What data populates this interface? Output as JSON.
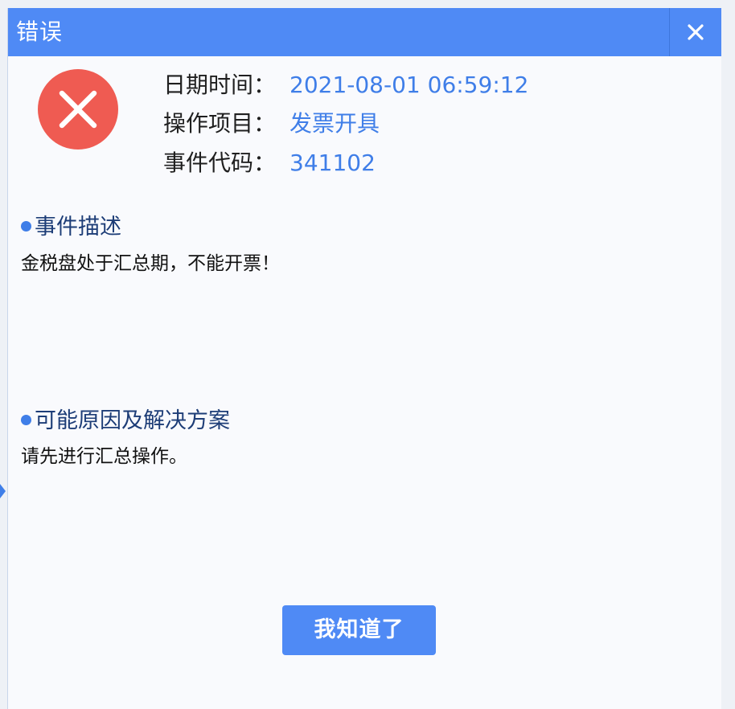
{
  "window": {
    "title": "错误",
    "close_icon": "close-icon"
  },
  "status_icon": "error-x-icon",
  "colors": {
    "titlebar": "#4f8af5",
    "error": "#ef5b52",
    "value_text": "#3f7ee8",
    "section_heading": "#1d3d77"
  },
  "details": {
    "datetime_label": "日期时间：",
    "datetime_value": "2021-08-01 06:59:12",
    "operation_label": "操作项目：",
    "operation_value": "发票开具",
    "event_code_label": "事件代码：",
    "event_code_value": "341102"
  },
  "description": {
    "heading": "事件描述",
    "text": "金税盘处于汇总期，不能开票！"
  },
  "solution": {
    "heading": "可能原因及解决方案",
    "text": "请先进行汇总操作。"
  },
  "actions": {
    "confirm_label": "我知道了"
  }
}
